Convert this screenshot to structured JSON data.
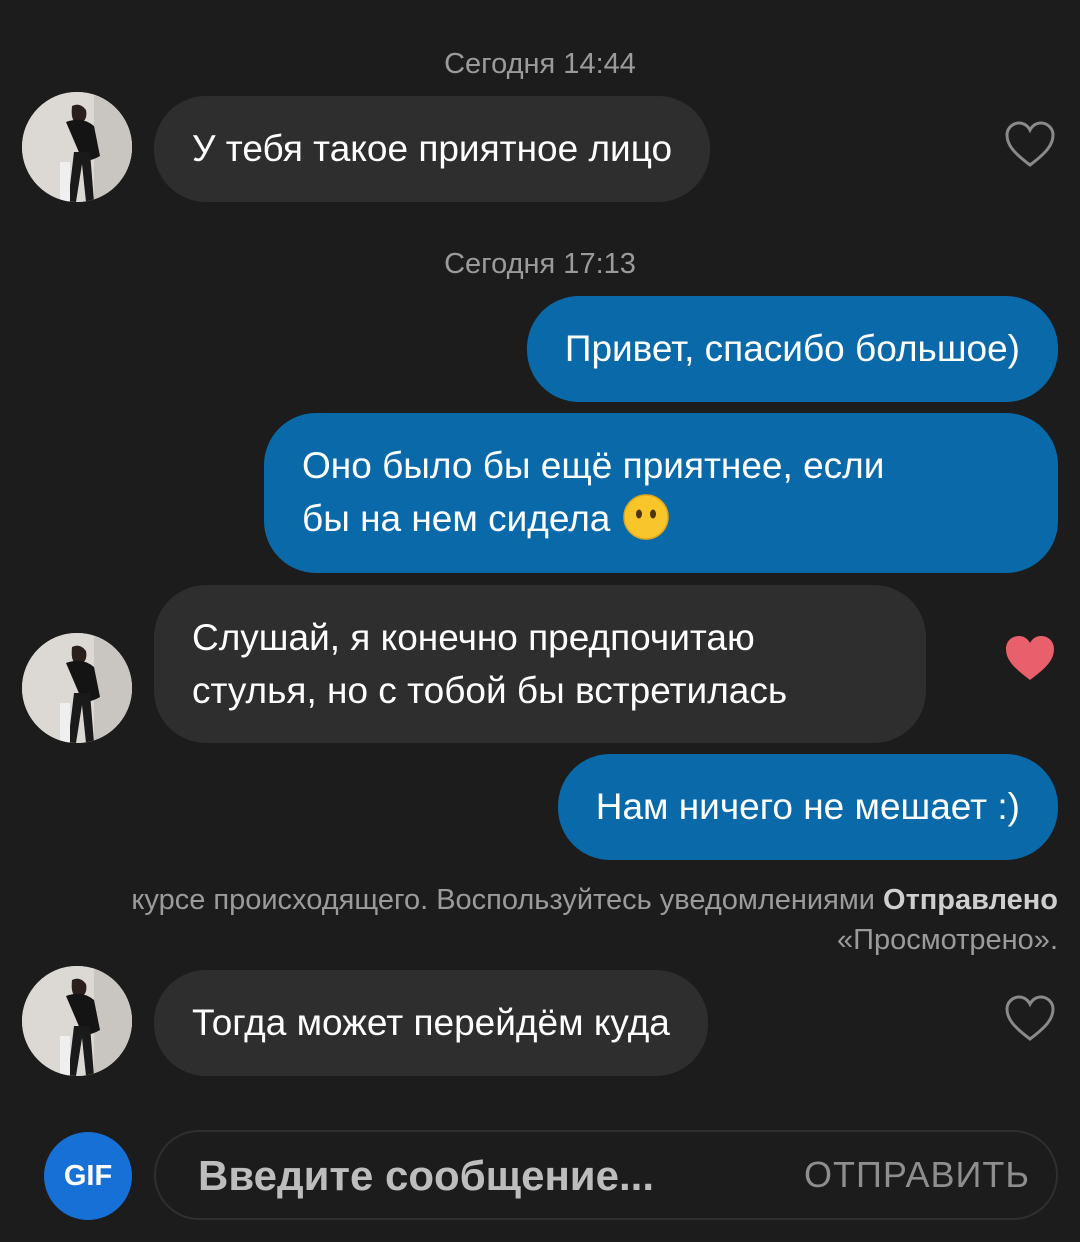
{
  "messages": {
    "timestamp_1": "Сегодня 14:44",
    "m1": "У тебя такое приятное лицо",
    "timestamp_2": "Сегодня 17:13",
    "m2": "Привет, спасибо большое)",
    "m3_line1": "Оно было бы ещё приятнее, если",
    "m3_line2": "бы на нем сидела",
    "m4_line1": "Слушай, я конечно предпочитаю",
    "m4_line2": "стулья, но с тобой бы встретилась",
    "m5": "Нам ничего не мешает :)",
    "m6": "Тогда может перейдём куда"
  },
  "likes": {
    "m1": "heart-outline",
    "m4": "heart-filled",
    "m6": "heart-outline"
  },
  "notice": {
    "prefix": "курсе происходящего. Воспользуйтесь уведомлениями ",
    "bold1": "Отправлено",
    "and_text": "",
    "bold2": "«Просмотрено»",
    "suffix": "."
  },
  "composer": {
    "gif_label": "GIF",
    "placeholder": "Введите сообщение...",
    "send_label": "ОТПРАВИТЬ"
  },
  "colors": {
    "background": "#1c1c1c",
    "incoming_bubble": "#2e2e2e",
    "outgoing_bubble": "#0a6aa9",
    "heart_filled": "#e8606c",
    "gif_button": "#1670d6"
  }
}
